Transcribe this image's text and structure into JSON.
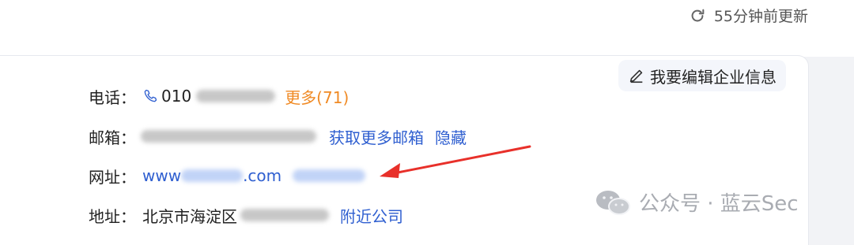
{
  "header": {
    "refresh_text": "55分钟前更新"
  },
  "edit_button": {
    "label": "我要编辑企业信息"
  },
  "contact": {
    "phone": {
      "label": "电话：",
      "value_prefix": "010",
      "more": "更多(71)"
    },
    "email": {
      "label": "邮箱：",
      "get_more": "获取更多邮箱",
      "hide": "隐藏"
    },
    "website": {
      "label": "网址：",
      "prefix": "www",
      "suffix": ".com"
    },
    "address": {
      "label": "地址：",
      "value": "北京市海淀区",
      "nearby": "附近公司"
    }
  },
  "watermark": {
    "text": "公众号 · 蓝云Sec"
  },
  "colors": {
    "link_blue": "#2f5fd0",
    "orange": "#f08a24",
    "arrow_red": "#e8302a"
  }
}
